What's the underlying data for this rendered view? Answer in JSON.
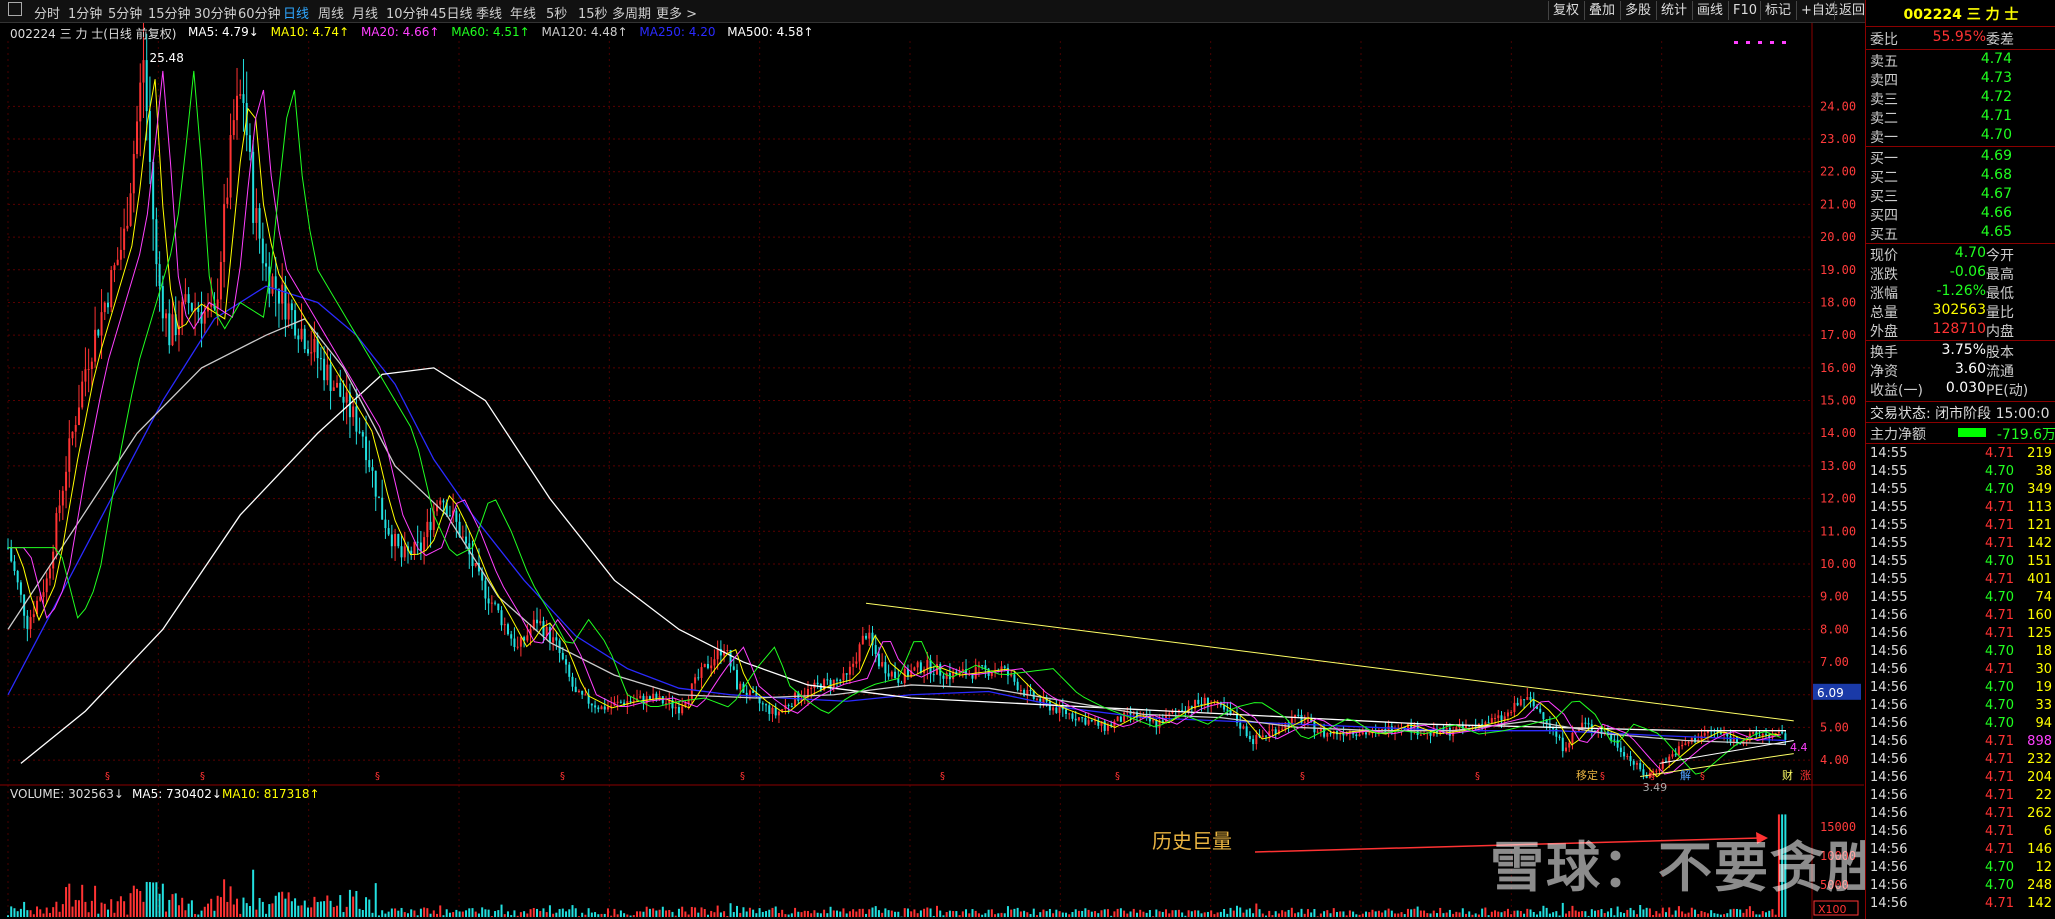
{
  "toolbar": {
    "tabs": [
      "分时",
      "1分钟",
      "5分钟",
      "15分钟",
      "30分钟",
      "60分钟",
      "日线",
      "周线",
      "月线",
      "10分钟",
      "45日线",
      "季线",
      "年线",
      "5秒",
      "15秒",
      "多周期",
      "更多 >"
    ],
    "active_tab": "日线",
    "right_buttons": [
      "复权",
      "叠加",
      "多股",
      "统计",
      "画线",
      "F10",
      "标记",
      "+自选",
      "返回"
    ]
  },
  "chart": {
    "title": "002224 三 力 士(日线 前复权)",
    "ma": [
      {
        "label": "MA5: 4.79↓",
        "color": "#ffffff"
      },
      {
        "label": "MA10: 4.74↑",
        "color": "#ffff00"
      },
      {
        "label": "MA20: 4.66↑",
        "color": "#ff40ff"
      },
      {
        "label": "MA60: 4.51↑",
        "color": "#20ff20"
      },
      {
        "label": "MA120: 4.48↑",
        "color": "#cccccc"
      },
      {
        "label": "MA250: 4.20",
        "color": "#2a2aff"
      },
      {
        "label": "MA500: 4.58↑",
        "color": "#ffffff"
      }
    ],
    "high_label": "25.48",
    "low_label": "3.49",
    "current_price_tag": "6.09",
    "right_edge_label": "4.4",
    "price_ticks": [
      "24.00",
      "23.00",
      "22.00",
      "21.00",
      "20.00",
      "19.00",
      "18.00",
      "17.00",
      "16.00",
      "15.00",
      "14.00",
      "13.00",
      "12.00",
      "11.00",
      "10.00",
      "9.00",
      "8.00",
      "7.00",
      "6.00",
      "5.00",
      "4.00"
    ],
    "markers": [
      "移定",
      "解",
      "财",
      "涨"
    ],
    "volume_title": "VOLUME: 302563↓",
    "volume_ma5": "MA5: 730402↓",
    "volume_ma10": "MA10: 817318↑",
    "volume_ticks": [
      "15000",
      "10000",
      "5000"
    ],
    "volume_unit": "X100",
    "annotation": "历史巨量",
    "watermark": "雪球：不要贪胜"
  },
  "chart_data": {
    "type": "candlestick",
    "title": "002224 三 力 士(日线 前复权)",
    "y_range": [
      3.3,
      26.0
    ],
    "y_unit": "price",
    "price_series": [
      [
        0,
        10.5
      ],
      [
        15,
        8.2
      ],
      [
        30,
        9.5
      ],
      [
        45,
        13
      ],
      [
        60,
        16
      ],
      [
        75,
        18
      ],
      [
        90,
        20
      ],
      [
        100,
        23.5
      ],
      [
        105,
        25.48
      ],
      [
        115,
        19
      ],
      [
        125,
        17
      ],
      [
        140,
        18
      ],
      [
        160,
        17.5
      ],
      [
        175,
        23.5
      ],
      [
        182,
        24.5
      ],
      [
        190,
        21
      ],
      [
        200,
        19
      ],
      [
        215,
        18
      ],
      [
        230,
        17
      ],
      [
        245,
        16
      ],
      [
        260,
        15
      ],
      [
        275,
        14
      ],
      [
        290,
        11.5
      ],
      [
        305,
        10.2
      ],
      [
        320,
        10.5
      ],
      [
        335,
        12.2
      ],
      [
        350,
        11
      ],
      [
        365,
        9.5
      ],
      [
        380,
        8.5
      ],
      [
        395,
        7.4
      ],
      [
        410,
        8.3
      ],
      [
        425,
        7.5
      ],
      [
        440,
        6.0
      ],
      [
        460,
        5.6
      ],
      [
        480,
        5.8
      ],
      [
        500,
        5.9
      ],
      [
        520,
        5.6
      ],
      [
        540,
        6.8
      ],
      [
        555,
        7.5
      ],
      [
        565,
        6.3
      ],
      [
        580,
        5.8
      ],
      [
        595,
        5.4
      ],
      [
        610,
        5.9
      ],
      [
        630,
        6.3
      ],
      [
        650,
        6.5
      ],
      [
        665,
        7.9
      ],
      [
        675,
        7.0
      ],
      [
        690,
        6.5
      ],
      [
        710,
        6.9
      ],
      [
        730,
        6.6
      ],
      [
        750,
        6.7
      ],
      [
        770,
        6.8
      ],
      [
        790,
        6.0
      ],
      [
        810,
        5.6
      ],
      [
        830,
        5.3
      ],
      [
        850,
        5.0
      ],
      [
        870,
        5.4
      ],
      [
        890,
        5.1
      ],
      [
        910,
        5.6
      ],
      [
        930,
        5.8
      ],
      [
        950,
        5.3
      ],
      [
        965,
        4.6
      ],
      [
        980,
        4.9
      ],
      [
        1000,
        5.3
      ],
      [
        1020,
        4.8
      ],
      [
        1040,
        4.9
      ],
      [
        1060,
        4.8
      ],
      [
        1080,
        5.1
      ],
      [
        1100,
        4.8
      ],
      [
        1120,
        4.9
      ],
      [
        1140,
        5.1
      ],
      [
        1160,
        5.3
      ],
      [
        1175,
        5.9
      ],
      [
        1190,
        5.4
      ],
      [
        1205,
        4.4
      ],
      [
        1220,
        5.1
      ],
      [
        1240,
        4.8
      ],
      [
        1260,
        3.9
      ],
      [
        1270,
        3.49
      ],
      [
        1285,
        4.0
      ],
      [
        1300,
        4.5
      ],
      [
        1320,
        4.9
      ],
      [
        1340,
        4.6
      ],
      [
        1360,
        4.8
      ],
      [
        1378,
        4.7
      ]
    ],
    "ma_lines": {
      "MA250": [
        [
          0,
          6
        ],
        [
          40,
          9
        ],
        [
          80,
          12
        ],
        [
          120,
          15
        ],
        [
          160,
          17.5
        ],
        [
          200,
          18.5
        ],
        [
          240,
          18
        ],
        [
          270,
          17
        ],
        [
          300,
          15.5
        ],
        [
          330,
          13.2
        ],
        [
          360,
          11.5
        ],
        [
          400,
          9.5
        ],
        [
          440,
          7.8
        ],
        [
          480,
          6.8
        ],
        [
          520,
          6.2
        ],
        [
          560,
          6.0
        ],
        [
          600,
          5.9
        ],
        [
          650,
          5.8
        ],
        [
          700,
          6.0
        ],
        [
          760,
          6.1
        ],
        [
          820,
          5.6
        ],
        [
          880,
          5.3
        ],
        [
          940,
          5.2
        ],
        [
          1000,
          5.1
        ],
        [
          1060,
          5.0
        ],
        [
          1120,
          4.9
        ],
        [
          1200,
          4.9
        ],
        [
          1280,
          4.75
        ],
        [
          1378,
          4.6
        ]
      ],
      "MA500": [
        [
          10,
          3.9
        ],
        [
          60,
          5.5
        ],
        [
          120,
          8
        ],
        [
          180,
          11.5
        ],
        [
          240,
          14
        ],
        [
          290,
          15.8
        ],
        [
          330,
          16
        ],
        [
          370,
          15
        ],
        [
          420,
          12
        ],
        [
          470,
          9.5
        ],
        [
          520,
          8
        ],
        [
          570,
          7
        ],
        [
          620,
          6.3
        ],
        [
          700,
          5.9
        ],
        [
          800,
          5.7
        ],
        [
          900,
          5.5
        ],
        [
          1000,
          5.3
        ],
        [
          1100,
          5.1
        ],
        [
          1200,
          5.0
        ],
        [
          1300,
          4.9
        ],
        [
          1378,
          4.9
        ]
      ],
      "MA120": [
        [
          0,
          8
        ],
        [
          50,
          11
        ],
        [
          100,
          14
        ],
        [
          150,
          16
        ],
        [
          200,
          17
        ],
        [
          230,
          17.5
        ],
        [
          260,
          16
        ],
        [
          300,
          13
        ],
        [
          340,
          11.5
        ],
        [
          380,
          9
        ],
        [
          420,
          7.6
        ],
        [
          470,
          6.6
        ],
        [
          520,
          6.0
        ],
        [
          580,
          5.9
        ],
        [
          640,
          6.0
        ],
        [
          700,
          6.3
        ],
        [
          760,
          6.2
        ],
        [
          820,
          5.8
        ],
        [
          880,
          5.4
        ],
        [
          940,
          5.3
        ],
        [
          1000,
          5.0
        ],
        [
          1060,
          4.9
        ],
        [
          1120,
          4.9
        ],
        [
          1180,
          5.2
        ],
        [
          1240,
          4.8
        ],
        [
          1300,
          4.6
        ],
        [
          1378,
          4.48
        ]
      ]
    },
    "trend_lines": [
      {
        "from": [
          665,
          8.8
        ],
        "to": [
          1384,
          5.2
        ],
        "color": "#ffff66"
      },
      {
        "from": [
          1265,
          3.5
        ],
        "to": [
          1384,
          4.2
        ],
        "color": "#ffff66"
      },
      {
        "from": [
          1280,
          3.9
        ],
        "to": [
          1384,
          4.6
        ],
        "color": "#ffffff"
      }
    ],
    "volume_range": [
      0,
      16000
    ],
    "volume_peak": 15000
  },
  "quote": {
    "title": "002224 三 力 士",
    "weibi_label": "委比",
    "weibi_value": "55.95%",
    "weicha_label": "委差",
    "sells": [
      {
        "label": "卖五",
        "price": "4.74"
      },
      {
        "label": "卖四",
        "price": "4.73"
      },
      {
        "label": "卖三",
        "price": "4.72"
      },
      {
        "label": "卖二",
        "price": "4.71"
      },
      {
        "label": "卖一",
        "price": "4.70"
      }
    ],
    "buys": [
      {
        "label": "买一",
        "price": "4.69"
      },
      {
        "label": "买二",
        "price": "4.68"
      },
      {
        "label": "买三",
        "price": "4.67"
      },
      {
        "label": "买四",
        "price": "4.66"
      },
      {
        "label": "买五",
        "price": "4.65"
      }
    ],
    "stats": [
      {
        "label": "现价",
        "value": "4.70",
        "value_color": "#20ff20",
        "label2": "今开"
      },
      {
        "label": "涨跌",
        "value": "-0.06",
        "value_color": "#20ff20",
        "label2": "最高"
      },
      {
        "label": "涨幅",
        "value": "-1.26%",
        "value_color": "#20ff20",
        "label2": "最低"
      },
      {
        "label": "总量",
        "value": "302563",
        "value_color": "#ffff00",
        "label2": "量比"
      },
      {
        "label": "外盘",
        "value": "128710",
        "value_color": "#ff3333",
        "label2": "内盘"
      }
    ],
    "stats2": [
      {
        "label": "换手",
        "value": "3.75%",
        "label2": "股本"
      },
      {
        "label": "净资",
        "value": "3.60",
        "label2": "流通"
      },
      {
        "label": "收益(一)",
        "value": "0.030",
        "label2": "PE(动)"
      }
    ],
    "trade_status": "交易状态: 闭市阶段 15:00:0",
    "main_flow_label": "主力净额",
    "main_flow_value": "-719.6万",
    "ticks": [
      {
        "t": "14:55",
        "p": "4.71",
        "v": "219",
        "c": "#ffff00"
      },
      {
        "t": "14:55",
        "p": "4.70",
        "v": "38",
        "c": "#ffff00"
      },
      {
        "t": "14:55",
        "p": "4.70",
        "v": "349",
        "c": "#ffff00"
      },
      {
        "t": "14:55",
        "p": "4.71",
        "v": "113",
        "c": "#ffff00"
      },
      {
        "t": "14:55",
        "p": "4.71",
        "v": "121",
        "c": "#ffff00"
      },
      {
        "t": "14:55",
        "p": "4.71",
        "v": "142",
        "c": "#ffff00"
      },
      {
        "t": "14:55",
        "p": "4.70",
        "v": "151",
        "c": "#ffff00"
      },
      {
        "t": "14:55",
        "p": "4.71",
        "v": "401",
        "c": "#ffff00"
      },
      {
        "t": "14:55",
        "p": "4.70",
        "v": "74",
        "c": "#ffff00"
      },
      {
        "t": "14:56",
        "p": "4.71",
        "v": "160",
        "c": "#ffff00"
      },
      {
        "t": "14:56",
        "p": "4.71",
        "v": "125",
        "c": "#ffff00"
      },
      {
        "t": "14:56",
        "p": "4.70",
        "v": "18",
        "c": "#ffff00"
      },
      {
        "t": "14:56",
        "p": "4.71",
        "v": "30",
        "c": "#ffff00"
      },
      {
        "t": "14:56",
        "p": "4.70",
        "v": "19",
        "c": "#ffff00"
      },
      {
        "t": "14:56",
        "p": "4.70",
        "v": "33",
        "c": "#ffff00"
      },
      {
        "t": "14:56",
        "p": "4.70",
        "v": "94",
        "c": "#ffff00"
      },
      {
        "t": "14:56",
        "p": "4.71",
        "v": "898",
        "c": "#ff40ff"
      },
      {
        "t": "14:56",
        "p": "4.71",
        "v": "232",
        "c": "#ffff00"
      },
      {
        "t": "14:56",
        "p": "4.71",
        "v": "204",
        "c": "#ffff00"
      },
      {
        "t": "14:56",
        "p": "4.71",
        "v": "22",
        "c": "#ffff00"
      },
      {
        "t": "14:56",
        "p": "4.71",
        "v": "262",
        "c": "#ffff00"
      },
      {
        "t": "14:56",
        "p": "4.71",
        "v": "6",
        "c": "#ffff00"
      },
      {
        "t": "14:56",
        "p": "4.71",
        "v": "146",
        "c": "#ffff00"
      },
      {
        "t": "14:56",
        "p": "4.70",
        "v": "12",
        "c": "#ffff00"
      },
      {
        "t": "14:56",
        "p": "4.70",
        "v": "248",
        "c": "#ffff00"
      },
      {
        "t": "14:56",
        "p": "4.71",
        "v": "142",
        "c": "#ffff00"
      }
    ]
  }
}
